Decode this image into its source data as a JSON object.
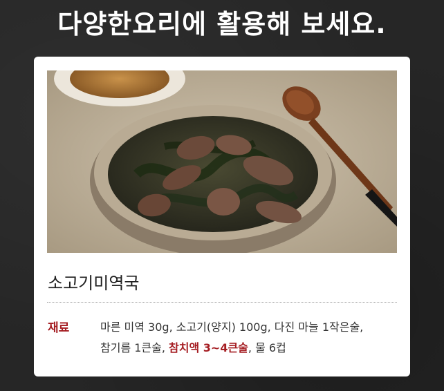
{
  "headline": "다양한요리에 활용해 보세요.",
  "recipe": {
    "title": "소고기미역국",
    "ingredients_label": "재료",
    "line1": "마른 미역 30g, 소고기(양지) 100g, 다진 마늘 1작은술,",
    "line2_pre": "참기름 1큰술, ",
    "line2_highlight": "참치액 3~4큰술",
    "line2_post": ", 물 6컵"
  },
  "colors": {
    "background": "#262626",
    "accent": "#a51d22",
    "card": "#ffffff"
  },
  "icons": {
    "photo": "seaweed-soup-photo"
  }
}
